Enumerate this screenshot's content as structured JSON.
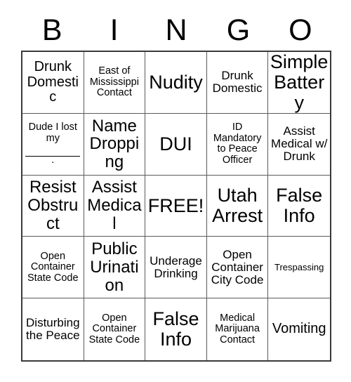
{
  "card": {
    "header_letters": [
      "B",
      "I",
      "N",
      "G",
      "O"
    ],
    "rows": [
      [
        {
          "text": "Drunk Domestic",
          "size": "lg"
        },
        {
          "text": "East of Mississippi Contact",
          "size": "sm"
        },
        {
          "text": "Nudity",
          "size": "xxl"
        },
        {
          "text": "Drunk Domestic",
          "size": "md"
        },
        {
          "text": "Simple Battery",
          "size": "xxl"
        }
      ],
      [
        {
          "text": "Dude I lost my ________.",
          "size": "sm",
          "kind": "fill-in-blank",
          "prefix": "Dude I lost my",
          "suffix": "."
        },
        {
          "text": "Name Dropping",
          "size": "xl"
        },
        {
          "text": "DUI",
          "size": "xxl"
        },
        {
          "text": "ID Mandatory to Peace Officer",
          "size": "sm"
        },
        {
          "text": "Assist Medical w/ Drunk",
          "size": "md"
        }
      ],
      [
        {
          "text": "Resist Obstruct",
          "size": "xl"
        },
        {
          "text": "Assist Medical",
          "size": "xl"
        },
        {
          "text": "FREE!",
          "size": "xxl",
          "kind": "free-space"
        },
        {
          "text": "Utah Arrest",
          "size": "xxl"
        },
        {
          "text": "False Info",
          "size": "xxl"
        }
      ],
      [
        {
          "text": "Open Container State Code",
          "size": "sm"
        },
        {
          "text": "Public Urination",
          "size": "xl"
        },
        {
          "text": "Underage Drinking",
          "size": "md"
        },
        {
          "text": "Open Container City Code",
          "size": "md"
        },
        {
          "text": "Trespassing",
          "size": "xs"
        }
      ],
      [
        {
          "text": "Disturbing the Peace",
          "size": "md"
        },
        {
          "text": "Open Container State Code",
          "size": "sm"
        },
        {
          "text": "False Info",
          "size": "xxl"
        },
        {
          "text": "Medical Marijuana Contact",
          "size": "sm"
        },
        {
          "text": "Vomiting",
          "size": "lg"
        }
      ]
    ]
  }
}
